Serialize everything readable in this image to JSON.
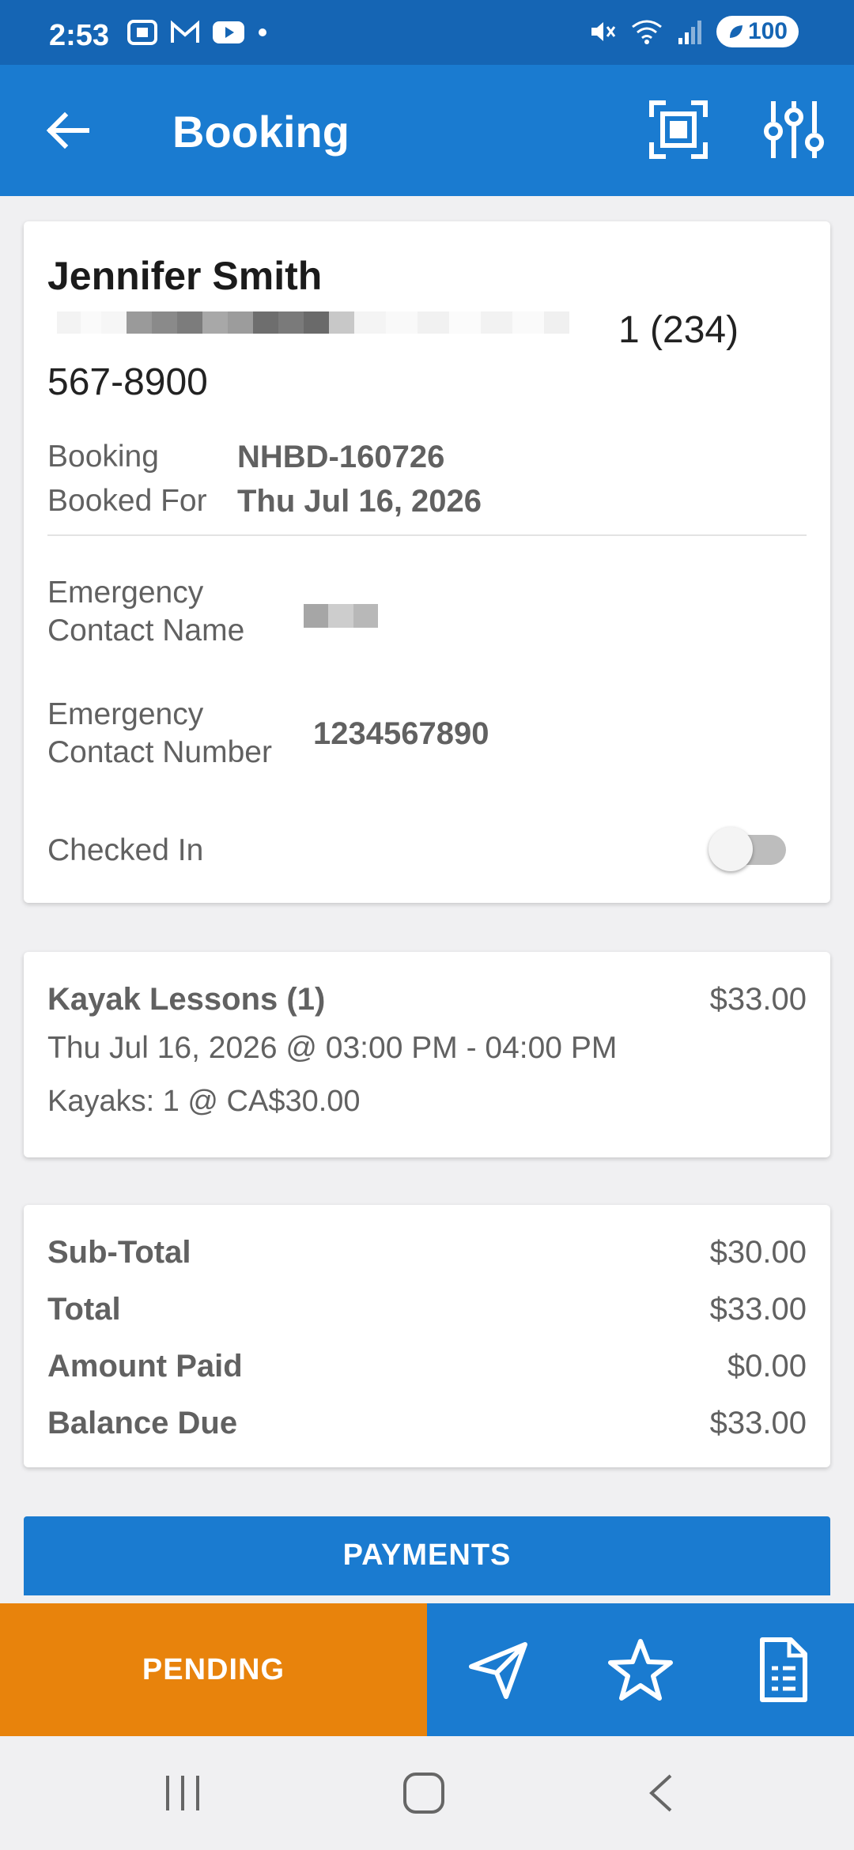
{
  "status_bar": {
    "time": "2:53",
    "battery": "100"
  },
  "app_bar": {
    "title": "Booking"
  },
  "customer": {
    "name": "Jennifer Smith",
    "phone_tail": "1 (234)",
    "phone_line2": "567-8900"
  },
  "booking": {
    "booking_label": "Booking",
    "booking_value": "NHBD-160726",
    "booked_for_label": "Booked For",
    "booked_for_value": "Thu Jul 16, 2026",
    "ec_name_label_1": "Emergency",
    "ec_name_label_2": "Contact Name",
    "ec_number_label_1": "Emergency",
    "ec_number_label_2": "Contact Number",
    "ec_number_value": "1234567890",
    "checked_in_label": "Checked In",
    "checked_in": false
  },
  "line_item": {
    "title": "Kayak Lessons (1)",
    "price": "$33.00",
    "datetime": "Thu Jul 16, 2026 @ 03:00 PM - 04:00 PM",
    "quantity": "Kayaks: 1 @ CA$30.00"
  },
  "totals": {
    "subtotal_label": "Sub-Total",
    "subtotal_value": "$30.00",
    "total_label": "Total",
    "total_value": "$33.00",
    "paid_label": "Amount Paid",
    "paid_value": "$0.00",
    "balance_label": "Balance Due",
    "balance_value": "$33.00"
  },
  "actions": {
    "payments": "PAYMENTS",
    "status": "PENDING"
  },
  "colors": {
    "app_bar": "#1a7bd0",
    "status_bar": "#1565b4",
    "pending": "#e8830c"
  },
  "icons": {
    "back": "arrow-left-icon",
    "scan": "scan-frame-icon",
    "filters": "sliders-icon",
    "send": "send-icon",
    "favorite": "star-icon",
    "details": "document-icon"
  }
}
